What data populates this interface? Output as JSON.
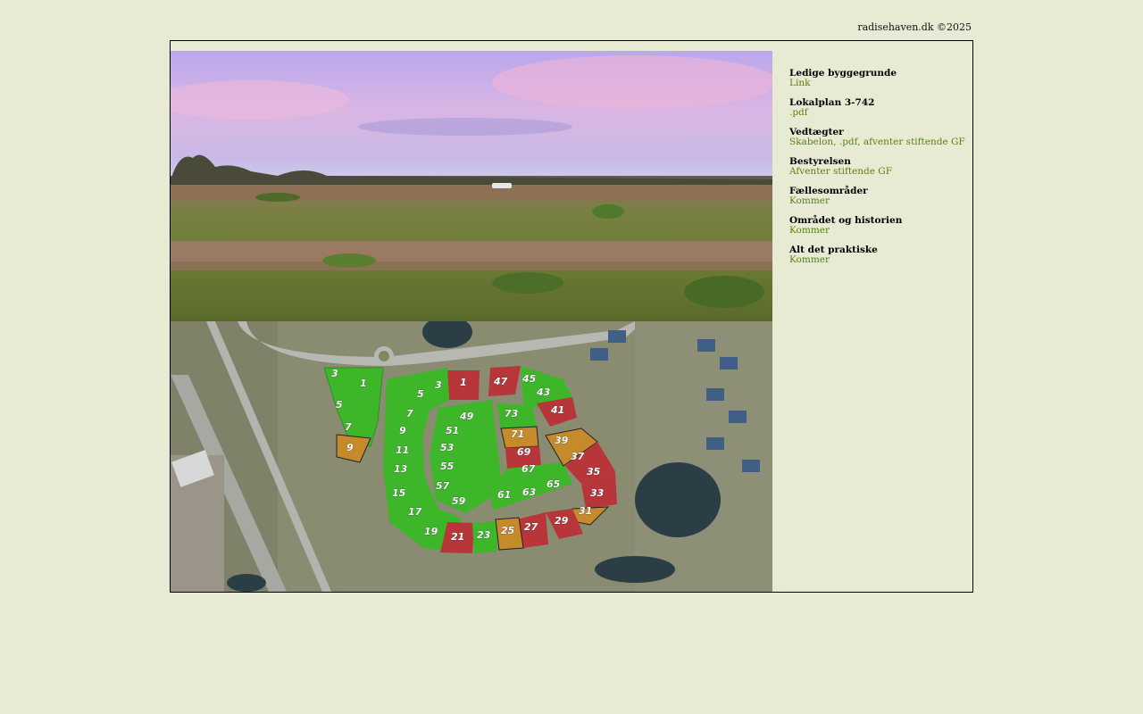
{
  "header": {
    "copyright": "radisehaven.dk ©2025"
  },
  "sidebar": {
    "items": [
      {
        "title": "Ledige byggegrunde",
        "link": "Link"
      },
      {
        "title": "Lokalplan 3-742",
        "link": ".pdf"
      },
      {
        "title": "Vedtægter",
        "link": "Skabelon, .pdf, afventer stiftende GF"
      },
      {
        "title": "Bestyrelsen",
        "link": "Afventer stiftende GF"
      },
      {
        "title": "Fællesområder",
        "link": "Kommer"
      },
      {
        "title": "Området og historien",
        "link": "Kommer"
      },
      {
        "title": "Alt det praktiske",
        "link": "Kommer"
      }
    ]
  },
  "map": {
    "lot_labels": [
      "3",
      "1",
      "5",
      "7",
      "9",
      "3",
      "1",
      "47",
      "45",
      "43",
      "41",
      "5",
      "7",
      "9",
      "11",
      "13",
      "15",
      "17",
      "19",
      "21",
      "23",
      "49",
      "51",
      "53",
      "55",
      "57",
      "59",
      "73",
      "71",
      "69",
      "67",
      "65",
      "63",
      "61",
      "39",
      "37",
      "35",
      "33",
      "31",
      "29",
      "27",
      "25"
    ],
    "colors": {
      "available": "#3db62a",
      "sold": "#b8353a",
      "reserved": "#c48a2c"
    }
  },
  "colors": {
    "background": "#e7ebd4",
    "link": "#5a7f10"
  }
}
